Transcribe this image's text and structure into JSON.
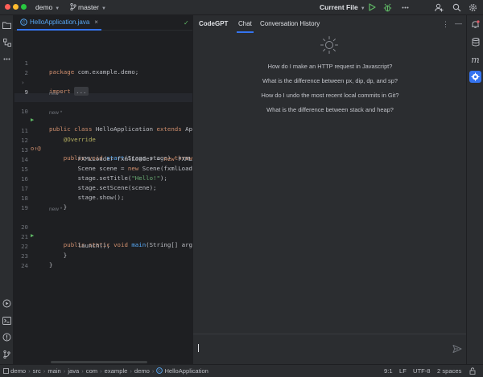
{
  "titlebar": {
    "project": "demo",
    "branch": "master",
    "run_config": "Current File"
  },
  "editor": {
    "tab_label": "HelloApplication.java",
    "lines": [
      {
        "n": "1",
        "t": "package com.example.demo;"
      },
      {
        "n": "2",
        "t": ""
      },
      {
        "n": "3",
        "t": "import ..."
      },
      {
        "n": "9",
        "t": ""
      },
      {
        "n": "10",
        "t": "public class HelloApplication extends App"
      },
      {
        "n": "11",
        "t": "    @Override"
      },
      {
        "n": "12",
        "t": "    public void start(Stage stage) throws I"
      },
      {
        "n": "13",
        "t": "        FXMLLoader fxmlLoader = new FXMLLoader"
      },
      {
        "n": "14",
        "t": "        Scene scene = new Scene(fxmlLoader.lo"
      },
      {
        "n": "15",
        "t": "        stage.setTitle(\"Hello!\");"
      },
      {
        "n": "16",
        "t": "        stage.setScene(scene);"
      },
      {
        "n": "17",
        "t": "        stage.show();"
      },
      {
        "n": "18",
        "t": "    }"
      },
      {
        "n": "19",
        "t": ""
      },
      {
        "n": "20",
        "t": "    public static void main(String[] args)"
      },
      {
        "n": "21",
        "t": "        launch();"
      },
      {
        "n": "22",
        "t": "    }"
      },
      {
        "n": "23",
        "t": "}"
      },
      {
        "n": "24",
        "t": ""
      }
    ],
    "hint_label": "new *"
  },
  "panel": {
    "title": "CodeGPT",
    "tab_chat": "Chat",
    "tab_history": "Conversation History",
    "suggestions": [
      "How do I make an HTTP request in Javascript?",
      "What is the difference between px, dip, dp, and sp?",
      "How do I undo the most recent local commits in Git?",
      "What is the difference between stack and heap?"
    ]
  },
  "statusbar": {
    "breadcrumbs": [
      "demo",
      "src",
      "main",
      "java",
      "com",
      "example",
      "demo",
      "HelloApplication"
    ],
    "position": "9:1",
    "line_sep": "LF",
    "encoding": "UTF-8",
    "indent": "2 spaces"
  },
  "colors": {
    "accent": "#3574f0",
    "run_green": "#5fb865",
    "keyword": "#cf8e6d",
    "string": "#6aab73",
    "function": "#56a8f5",
    "annotation": "#b3ae60"
  }
}
